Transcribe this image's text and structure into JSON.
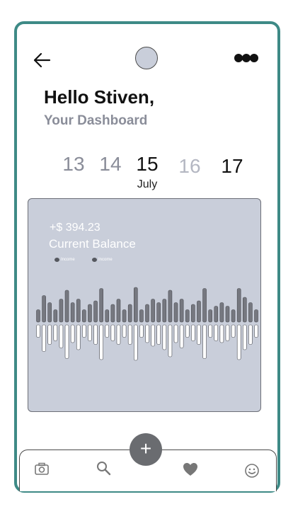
{
  "header": {
    "back_icon": "arrow-left-icon",
    "menu_icon": "more-dots-icon",
    "greeting": "Hello Stiven,",
    "subtitle": "Your Dashboard"
  },
  "dates": {
    "days": [
      "13",
      "14",
      "15",
      "16",
      "17"
    ],
    "selected_day": "15",
    "month": "July"
  },
  "balance_card": {
    "amount": "+$ 394.23",
    "label": "Current Balance",
    "legend": [
      "Income",
      "Income"
    ],
    "chart_data": {
      "type": "bar",
      "up_values": [
        0.35,
        0.75,
        0.55,
        0.35,
        0.65,
        0.9,
        0.55,
        0.65,
        0.35,
        0.5,
        0.6,
        0.95,
        0.35,
        0.5,
        0.65,
        0.35,
        0.5,
        0.98,
        0.35,
        0.5,
        0.65,
        0.55,
        0.65,
        0.9,
        0.55,
        0.65,
        0.35,
        0.5,
        0.6,
        0.95,
        0.35,
        0.45,
        0.55,
        0.45,
        0.35,
        0.95,
        0.7,
        0.55,
        0.35
      ],
      "down_values": [
        0.35,
        0.75,
        0.55,
        0.45,
        0.65,
        0.95,
        0.5,
        0.7,
        0.35,
        0.45,
        0.55,
        0.98,
        0.35,
        0.45,
        0.55,
        0.35,
        0.55,
        1.0,
        0.35,
        0.5,
        0.6,
        0.55,
        0.7,
        0.9,
        0.5,
        0.65,
        0.35,
        0.45,
        0.55,
        0.95,
        0.35,
        0.45,
        0.5,
        0.45,
        0.35,
        0.98,
        0.7,
        0.55,
        0.35
      ]
    }
  },
  "navbar": {
    "icons": [
      "camera-icon",
      "search-icon",
      "plus-icon",
      "heart-icon",
      "smile-icon"
    ],
    "add_label": "+"
  },
  "colors": {
    "frame": "#3e8a86",
    "card_bg": "#c9ceda",
    "accent_gray": "#8a8d99",
    "button_bg": "#6a6c70"
  }
}
